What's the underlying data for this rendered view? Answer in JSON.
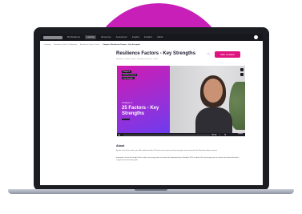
{
  "nav": {
    "logo": "Resilience Institute",
    "items": [
      {
        "label": "My Resilience",
        "active": false
      },
      {
        "label": "Learning",
        "active": true
      },
      {
        "label": "Resources",
        "active": false
      },
      {
        "label": "Assessment",
        "active": false
      },
      {
        "label": "Insights",
        "active": false
      },
      {
        "label": "Invitation",
        "active": false
      },
      {
        "label": "Admin",
        "active": false
      }
    ]
  },
  "breadcrumbs": [
    "Learning",
    "Resilience Coach Certification",
    "Resilience Coach Course",
    "Chapter 4 Resilience Factors - Key Strengths"
  ],
  "page": {
    "title": "Resilience Factors - Key Strengths",
    "subtitle": "Resilience Coach Course · Resilience Factors · Video",
    "mark_complete": "Mark Complete"
  },
  "video": {
    "tag1": "Chapter 4",
    "tag2": "Resilience Factors",
    "tag3": "Key Strengths",
    "chapter": "Chapter 4",
    "title": "25 Factors - Key Strengths",
    "time": "00:00",
    "player": "vimeo"
  },
  "about": {
    "heading": "About",
    "p1": "By the end of this video, you will understand the 25 factors that represent key strengths measured with the Resilience Assessment.",
    "p2": "Important: Given the length of this video, you may prefer to review the download key Strengths PDF instead. We encourage you to choose the format that best supports your learning style."
  },
  "colors": {
    "accent": "#e0147e",
    "blob": "#c81fb8",
    "nav_bg": "#17181d"
  }
}
